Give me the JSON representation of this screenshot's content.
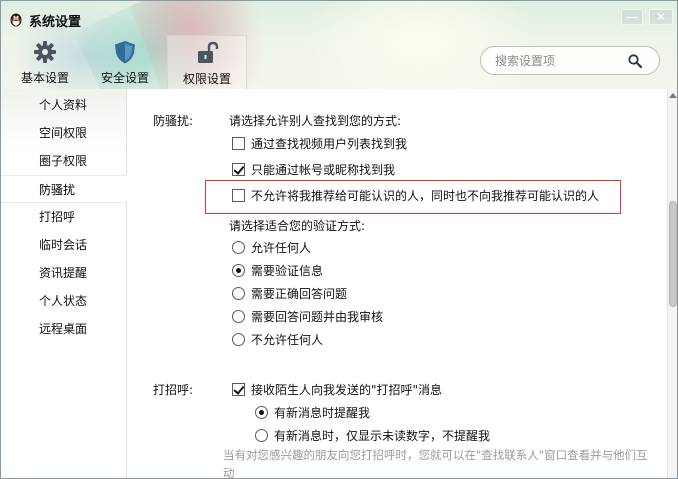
{
  "window": {
    "title": "系统设置",
    "minimize_glyph": "—",
    "close_glyph": "✕"
  },
  "tabs": [
    {
      "label": "基本设置",
      "icon": "gear-icon",
      "active": false
    },
    {
      "label": "安全设置",
      "icon": "shield-icon",
      "active": false
    },
    {
      "label": "权限设置",
      "icon": "unlock-icon",
      "active": true
    }
  ],
  "search": {
    "placeholder": "搜索设置项",
    "value": ""
  },
  "sidebar": {
    "items": [
      {
        "label": "个人资料",
        "active": false
      },
      {
        "label": "空间权限",
        "active": false
      },
      {
        "label": "圈子权限",
        "active": false
      },
      {
        "label": "防骚扰",
        "active": true
      },
      {
        "label": "打招呼",
        "active": false
      },
      {
        "label": "临时会话",
        "active": false
      },
      {
        "label": "资讯提醒",
        "active": false
      },
      {
        "label": "个人状态",
        "active": false
      },
      {
        "label": "远程桌面",
        "active": false
      }
    ]
  },
  "anti_harass": {
    "section_label": "防骚扰:",
    "find_prompt": "请选择允许别人查找到您的方式:",
    "find_options": [
      {
        "label": "通过查找视频用户列表找到我",
        "checked": false
      },
      {
        "label": "只能通过帐号或昵称找到我",
        "checked": true
      },
      {
        "label": "不允许将我推荐给可能认识的人，同时也不向我推荐可能认识的人",
        "checked": false
      }
    ],
    "verify_prompt": "请选择适合您的验证方式:",
    "verify_options": [
      {
        "label": "允许任何人",
        "selected": false
      },
      {
        "label": "需要验证信息",
        "selected": true
      },
      {
        "label": "需要正确回答问题",
        "selected": false
      },
      {
        "label": "需要回答问题并由我审核",
        "selected": false
      },
      {
        "label": "不允许任何人",
        "selected": false
      }
    ]
  },
  "greeting": {
    "section_label": "打招呼:",
    "accept_option": {
      "label": "接收陌生人向我发送的\"打招呼\"消息",
      "checked": true
    },
    "remind_options": [
      {
        "label": "有新消息时提醒我",
        "selected": true
      },
      {
        "label": "有新消息时，仅显示未读数字，不提醒我",
        "selected": false
      }
    ],
    "hint": "当有对您感兴趣的朋友向您打招呼时，您就可以在\"查找联系人\"窗口查看并与他们互动"
  },
  "colors": {
    "highlight_border": "#d33b3b",
    "hint_text": "#9a9a9a"
  }
}
